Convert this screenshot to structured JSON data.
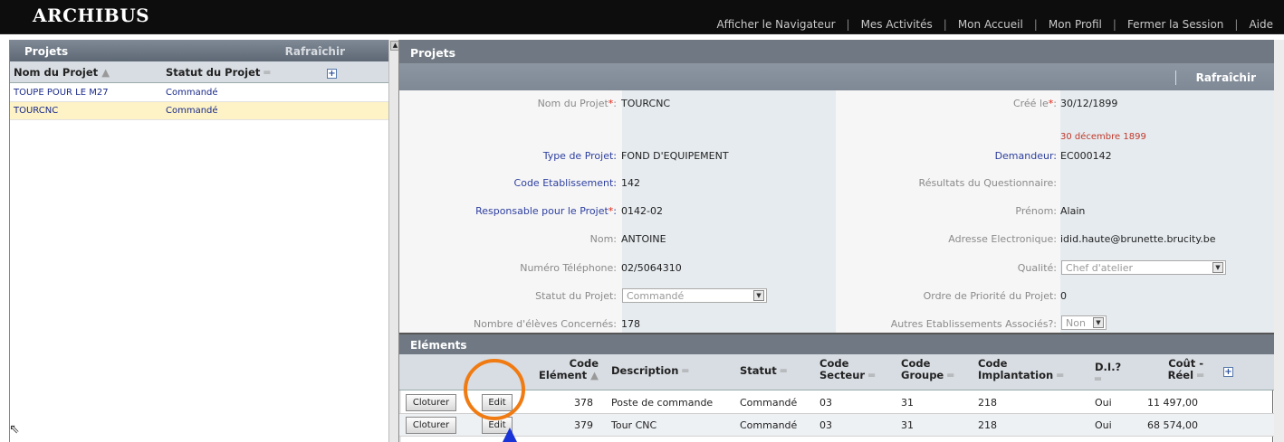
{
  "app": {
    "logo": "ARCHIBUS",
    "nav": [
      "Afficher le Navigateur",
      "Mes Activités",
      "Mon Accueil",
      "Mon Profil",
      "Fermer la Session",
      "Aide"
    ]
  },
  "left_panel": {
    "title": "Projets",
    "refresh": "Rafraîchir",
    "columns": [
      "Nom du Projet",
      "Statut du Projet"
    ],
    "rows": [
      {
        "name": "TOUPE POUR LE M27",
        "status": "Commandé"
      },
      {
        "name": "TOURCNC",
        "status": "Commandé"
      }
    ]
  },
  "project_panel": {
    "title": "Projets",
    "refresh": "Rafraîchir",
    "fields": {
      "nom_label": "Nom du Projet",
      "nom_value": "TOURCNC",
      "cree_label": "Créé le",
      "cree_value": "30/12/1899",
      "cree_hint": "30 décembre 1899",
      "type_label": "Type de Projet:",
      "type_value": "FOND D'EQUIPEMENT",
      "demandeur_label": "Demandeur:",
      "demandeur_value": "EC000142",
      "code_etab_label": "Code Etablissement:",
      "code_etab_value": "142",
      "resultats_label": "Résultats du Questionnaire:",
      "responsable_label": "Responsable pour le Projet",
      "responsable_value": "0142-02",
      "prenom_label": "Prénom:",
      "prenom_value": "Alain",
      "nom2_label": "Nom:",
      "nom2_value": "ANTOINE",
      "email_label": "Adresse Electronique:",
      "email_value": "idid.haute@brunette.brucity.be",
      "tel_label": "Numéro Téléphone:",
      "tel_value": "02/5064310",
      "qualite_label": "Qualité:",
      "qualite_value": "Chef d'atelier",
      "statut_label": "Statut du Projet:",
      "statut_value": "Commandé",
      "priorite_label": "Ordre de Priorité du Projet:",
      "priorite_value": "0",
      "eleves_label": "Nombre d'élèves Concernés:",
      "eleves_value": "178",
      "autres_label": "Autres Etablissements Associés?:",
      "autres_value": "Non"
    }
  },
  "elements_panel": {
    "title": "Eléments",
    "columns": {
      "code_element": [
        "Code",
        "Elément"
      ],
      "description": "Description",
      "statut": "Statut",
      "code_secteur": [
        "Code",
        "Secteur"
      ],
      "code_groupe": [
        "Code",
        "Groupe"
      ],
      "code_implantation": [
        "Code",
        "Implantation"
      ],
      "di": "D.I.?",
      "cout_reel": [
        "Coût -",
        "Réel"
      ]
    },
    "close_label": "Cloturer",
    "edit_label": "Edit",
    "rows": [
      {
        "code": "378",
        "description": "Poste de commande",
        "statut": "Commandé",
        "secteur": "03",
        "groupe": "31",
        "implantation": "218",
        "di": "Oui",
        "cout": "11 497,00"
      },
      {
        "code": "379",
        "description": "Tour CNC",
        "statut": "Commandé",
        "secteur": "03",
        "groupe": "31",
        "implantation": "218",
        "di": "Oui",
        "cout": "68 574,00"
      }
    ]
  },
  "annotation_colors": {
    "circle": "#f07b12",
    "arrow": "#1a33d6"
  }
}
